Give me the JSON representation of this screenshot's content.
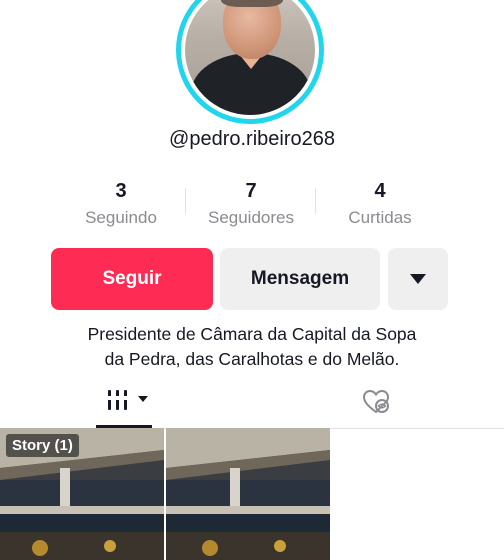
{
  "profile": {
    "username": "@pedro.ribeiro268",
    "avatar_ring_color": "#20d5ec"
  },
  "stats": [
    {
      "value": "3",
      "label": "Seguindo"
    },
    {
      "value": "7",
      "label": "Seguidores"
    },
    {
      "value": "4",
      "label": "Curtidas"
    }
  ],
  "actions": {
    "follow_label": "Seguir",
    "message_label": "Mensagem",
    "more_icon": "caret-down-icon",
    "follow_color": "#fe2c55"
  },
  "bio": {
    "line1": "Presidente de Câmara da Capital da Sopa",
    "line2": "da Pedra, das Caralhotas e do Melão."
  },
  "tabs": {
    "videos_icon": "grid-bars-icon",
    "liked_icon": "liked-hidden-icon"
  },
  "videos": [
    {
      "label": "Story (1)"
    },
    {
      "label": ""
    }
  ]
}
